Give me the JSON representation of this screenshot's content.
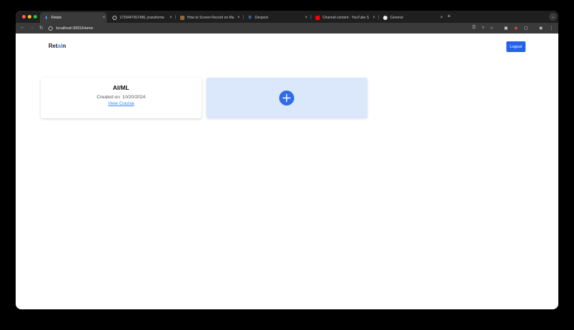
{
  "browser": {
    "tabs": [
      {
        "title": "Retain",
        "active": true
      },
      {
        "title": "1729447067486_transforme",
        "active": false
      },
      {
        "title": "How to Screen Record on Ma",
        "active": false
      },
      {
        "title": "Devpost",
        "active": false
      },
      {
        "title": "Channel content - YouTube S",
        "active": false
      },
      {
        "title": "General",
        "active": false
      }
    ],
    "new_tab": "+",
    "url": "localhost:3001/Home"
  },
  "app": {
    "logo_pre": "Ret",
    "logo_ai": "ai",
    "logo_post": "n",
    "logout_label": "Logout"
  },
  "courses": [
    {
      "title": "AI/ML",
      "created": "Created on: 10/20/2024",
      "link": "View Course"
    }
  ],
  "colors": {
    "accent": "#2563eb",
    "add_card_bg": "#dbe7fb"
  }
}
